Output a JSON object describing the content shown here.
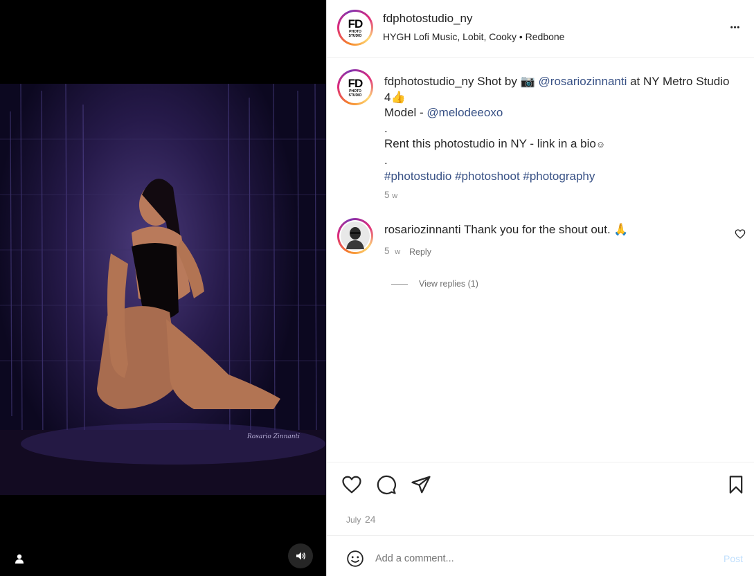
{
  "post": {
    "username": "fdphotostudio_ny",
    "audio": "HYGH Lofi Music, Lobit, Cooky • Redbone",
    "logo_big": "FD",
    "logo_small": "PHOTO",
    "logo_small2": "STUDIO",
    "more_label": "•••",
    "date_month": "July",
    "date_day": "24"
  },
  "caption": {
    "username": "fdphotostudio_ny",
    "text_1": "Shot by",
    "camera_emoji": "📷",
    "mention_1": "@rosariozinnanti",
    "text_2": "at NY Metro Studio 4",
    "thumbs_emoji": "👍",
    "model_label": "Model -",
    "mention_2": "@melodeeoxo",
    "dot_1": ".",
    "text_3": "Rent this photostudio in NY - link in a bio",
    "smile_emoji": "☺",
    "dot_2": ".",
    "hashtags": "#photostudio #photoshoot #photography",
    "time_num": "5",
    "time_unit": "w"
  },
  "comment": {
    "username": "rosariozinnanti",
    "text": "Thank you for the shout out.",
    "emoji": "🙏",
    "time_num": "5",
    "time_unit": "w",
    "reply_label": "Reply",
    "view_replies": "View replies (1)"
  },
  "composer": {
    "placeholder": "Add a comment...",
    "post_label": "Post"
  },
  "photo": {
    "signature": "Rosario Zinnanti"
  },
  "colors": {
    "link": "#385185",
    "muted": "#8e8e8e",
    "post_disabled": "#c0dffd"
  }
}
